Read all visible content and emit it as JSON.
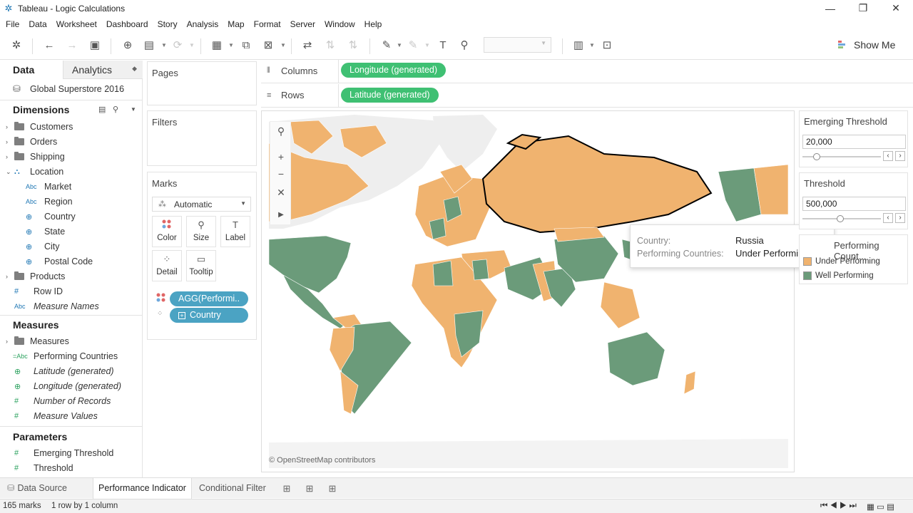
{
  "window": {
    "title": "Tableau - Logic Calculations",
    "minimize": "—",
    "restore": "❐",
    "close": "✕"
  },
  "menu": [
    "File",
    "Data",
    "Worksheet",
    "Dashboard",
    "Story",
    "Analysis",
    "Map",
    "Format",
    "Server",
    "Window",
    "Help"
  ],
  "toolbar": {
    "show_me": "Show Me"
  },
  "data_pane": {
    "tab_data": "Data",
    "tab_analytics": "Analytics",
    "data_source": "Global Superstore 2016",
    "dimensions_label": "Dimensions",
    "dimensions": [
      {
        "label": "Customers",
        "type": "folder"
      },
      {
        "label": "Orders",
        "type": "folder"
      },
      {
        "label": "Shipping",
        "type": "folder"
      },
      {
        "label": "Location",
        "type": "hierarchy"
      },
      {
        "label": "Market",
        "type": "abc"
      },
      {
        "label": "Region",
        "type": "abc"
      },
      {
        "label": "Country",
        "type": "geo"
      },
      {
        "label": "State",
        "type": "geo"
      },
      {
        "label": "City",
        "type": "geo"
      },
      {
        "label": "Postal Code",
        "type": "geo"
      },
      {
        "label": "Products",
        "type": "folder"
      },
      {
        "label": "Row ID",
        "type": "number"
      },
      {
        "label": "Measure Names",
        "type": "abc"
      }
    ],
    "measures_label": "Measures",
    "measures": [
      {
        "label": "Measures",
        "type": "folder"
      },
      {
        "label": "Performing Countries",
        "type": "calc-abc"
      },
      {
        "label": "Latitude (generated)",
        "type": "geo"
      },
      {
        "label": "Longitude (generated)",
        "type": "geo"
      },
      {
        "label": "Number of Records",
        "type": "number"
      },
      {
        "label": "Measure Values",
        "type": "number"
      }
    ],
    "parameters_label": "Parameters",
    "parameters": [
      {
        "label": "Emerging Threshold",
        "type": "number"
      },
      {
        "label": "Threshold",
        "type": "number"
      }
    ]
  },
  "cards": {
    "pages": "Pages",
    "filters": "Filters",
    "marks": "Marks",
    "mark_type": "Automatic",
    "mark_buttons": [
      "Color",
      "Size",
      "Label",
      "Detail",
      "Tooltip"
    ],
    "mark_pills": [
      "AGG(Performi..",
      "Country"
    ]
  },
  "shelves": {
    "columns_label": "Columns",
    "columns_pill": "Longitude (generated)",
    "rows_label": "Rows",
    "rows_pill": "Latitude (generated)"
  },
  "map": {
    "attribution": "© OpenStreetMap contributors",
    "colors": {
      "under": "#f0b36f",
      "well": "#6b9b7a",
      "land_other": "#eeeeee"
    }
  },
  "tooltip": {
    "country_label": "Country:",
    "country_value": "Russia",
    "perf_label": "Performing Countries:",
    "perf_value": "Under Performing"
  },
  "right_pane": {
    "emerging": {
      "title": "Emerging Threshold",
      "value": "20,000",
      "level": 0.18
    },
    "threshold": {
      "title": "Threshold",
      "value": "500,000",
      "level": 0.48
    },
    "legend": {
      "title": "Performing Count...",
      "items": [
        {
          "label": "Under Performing",
          "color": "#f0b36f"
        },
        {
          "label": "Well Performing",
          "color": "#6b9b7a"
        }
      ]
    }
  },
  "sheet_tabs": {
    "data_source": "Data Source",
    "tabs": [
      "Performance Indicator",
      "Conditional Filter"
    ]
  },
  "status": {
    "marks": "165 marks",
    "rows_cols": "1 row by 1 column"
  }
}
